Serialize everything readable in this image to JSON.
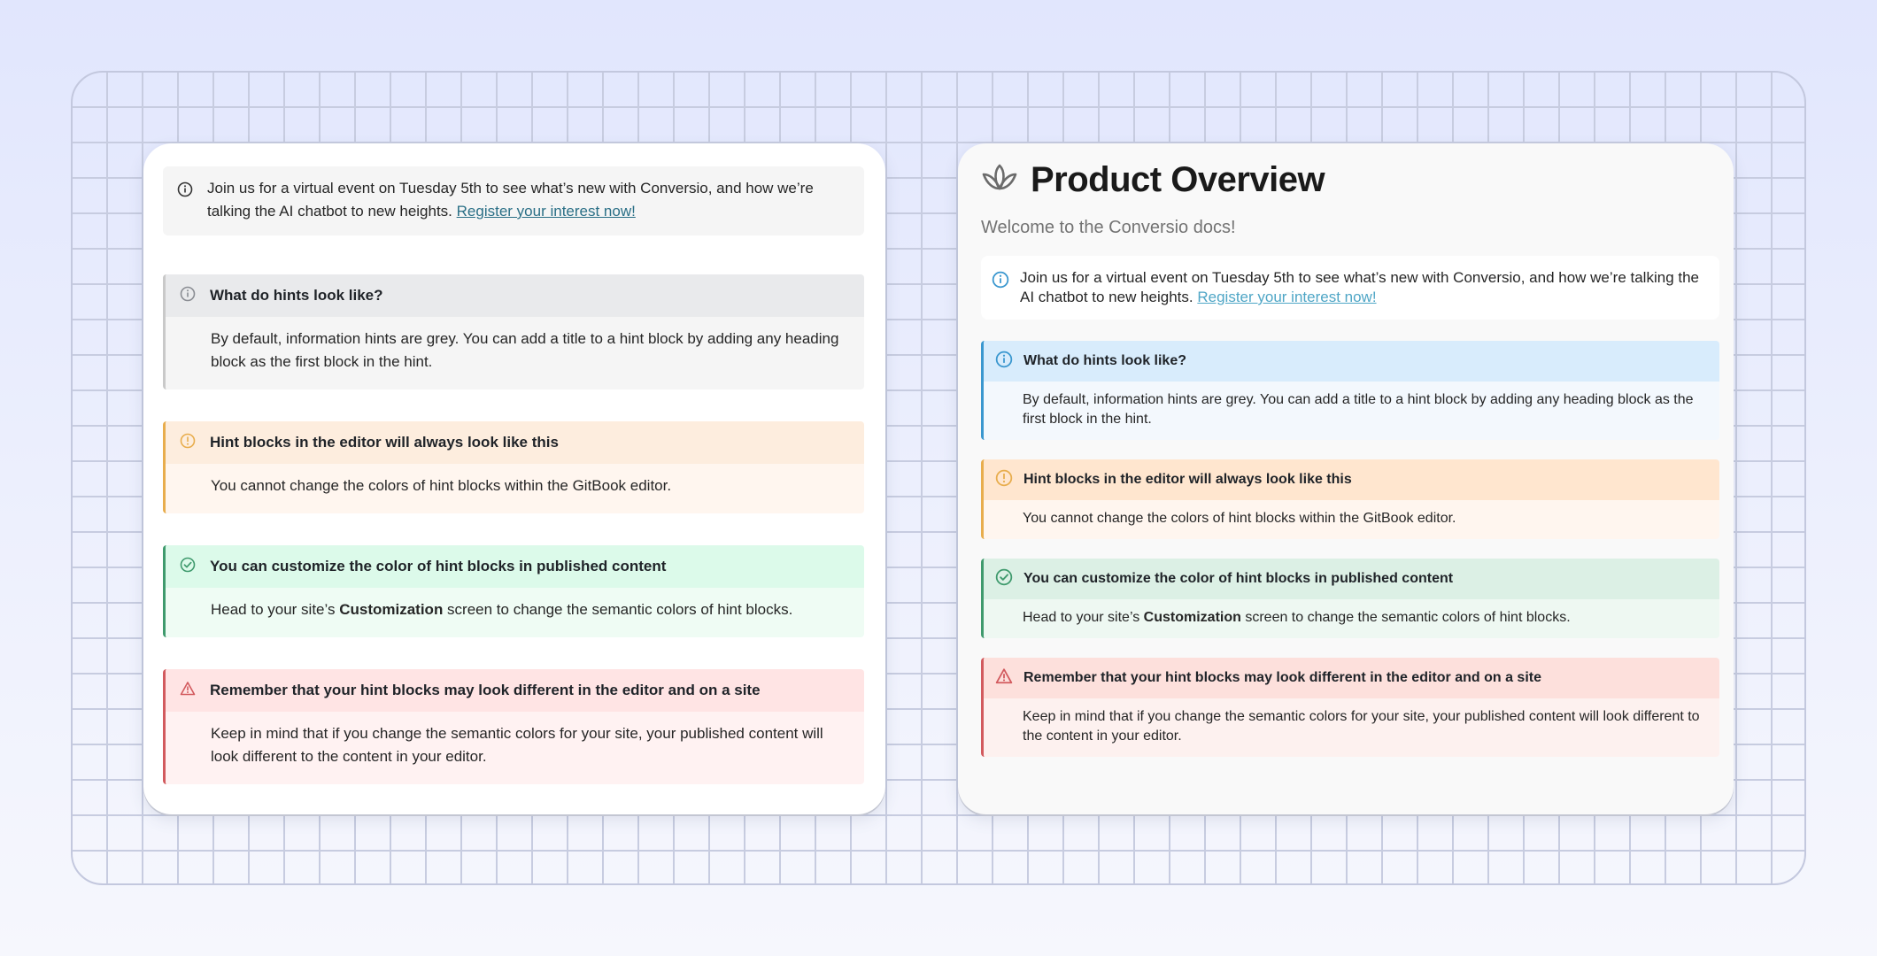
{
  "announcement": {
    "text": "Join us for a virtual event on Tuesday 5th to see what’s new with Conversio, and how we’re talking the AI chatbot to new heights. ",
    "link": "Register your interest now!"
  },
  "editor_view": {
    "hints": [
      {
        "type": "info",
        "title": "What do hints look like?",
        "body": "By default, information hints are grey. You can add a title to a hint block by adding any heading block as the first block in the hint."
      },
      {
        "type": "warning",
        "title": "Hint blocks in the editor will always look like this",
        "body": "You cannot change the colors of hint blocks within the GitBook editor."
      },
      {
        "type": "success",
        "title": "You can customize the color of hint blocks in published content",
        "body_before": "Head to your site’s ",
        "body_bold": "Customization",
        "body_after": " screen to change the semantic colors of hint blocks."
      },
      {
        "type": "danger",
        "title": "Remember that your hint blocks may look different in the editor and on a site",
        "body": "Keep in mind that if you change the semantic colors for your site, your published content will look different to the content in your editor."
      }
    ]
  },
  "published_view": {
    "title": "Product Overview",
    "subtitle": "Welcome to the Conversio docs!",
    "logo_icon": "lotus-icon"
  },
  "colors": {
    "info_grey": "#c9c9c9",
    "info_blue": "#3a97cf",
    "warning": "#e8ad4d",
    "success": "#3f9a6d",
    "danger": "#d25a5e"
  }
}
